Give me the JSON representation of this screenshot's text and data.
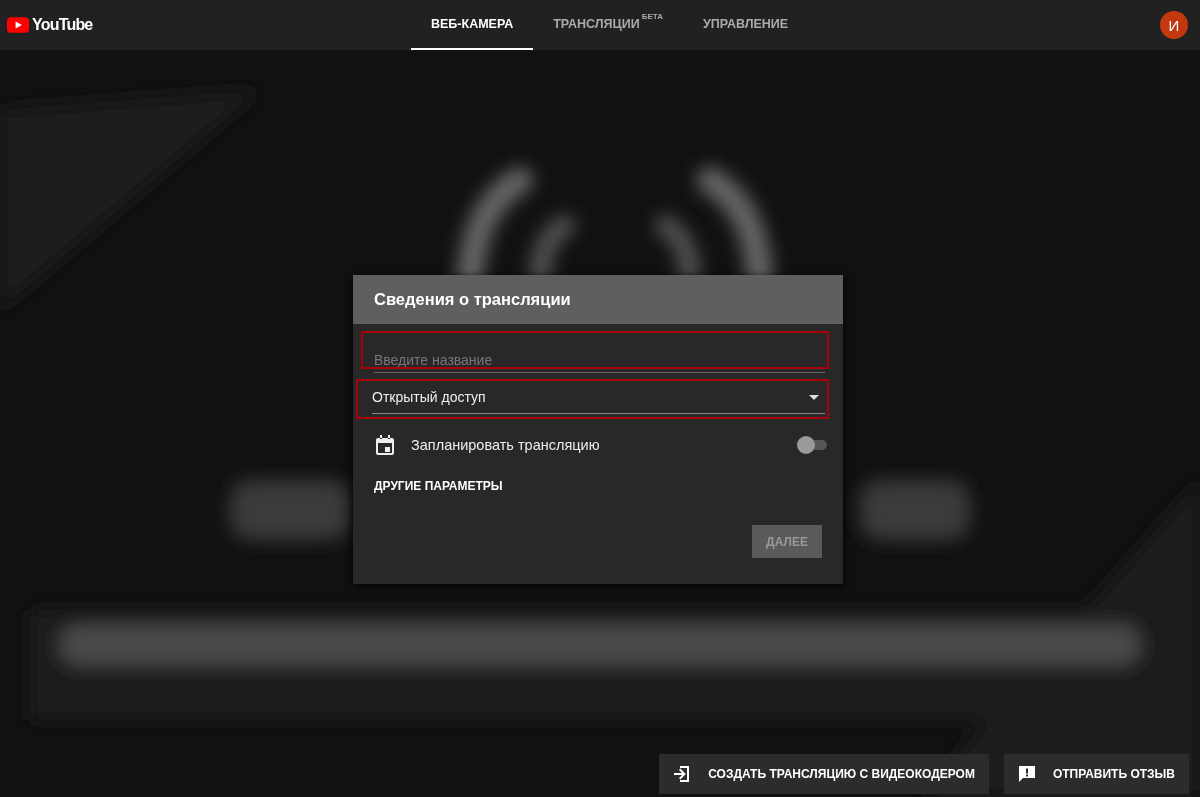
{
  "header": {
    "logo_text": "YouTube",
    "tabs": [
      {
        "label": "ВЕБ-КАМЕРА",
        "selected": true
      },
      {
        "label": "ТРАНСЛЯЦИИ",
        "badge": "БЕТА",
        "selected": false
      },
      {
        "label": "УПРАВЛЕНИЕ",
        "selected": false
      }
    ],
    "avatar": {
      "initial": "И",
      "color": "#c4380f"
    }
  },
  "dialog": {
    "title": "Сведения о трансляции",
    "title_field": {
      "placeholder": "Введите название",
      "highlighted": true
    },
    "privacy_select": {
      "value": "Открытый доступ",
      "highlighted": true
    },
    "schedule": {
      "label": "Запланировать трансляцию",
      "on": false
    },
    "more_options": "ДРУГИЕ ПАРАМЕТРЫ",
    "next_button": {
      "label": "ДАЛЕЕ",
      "disabled": true
    }
  },
  "bottom_buttons": [
    {
      "kind": "encoder",
      "label": "СОЗДАТЬ ТРАНСЛЯЦИЮ С ВИДЕОКОДЕРОМ"
    },
    {
      "kind": "feedback",
      "label": "ОТПРАВИТЬ ОТЗЫВ"
    }
  ]
}
